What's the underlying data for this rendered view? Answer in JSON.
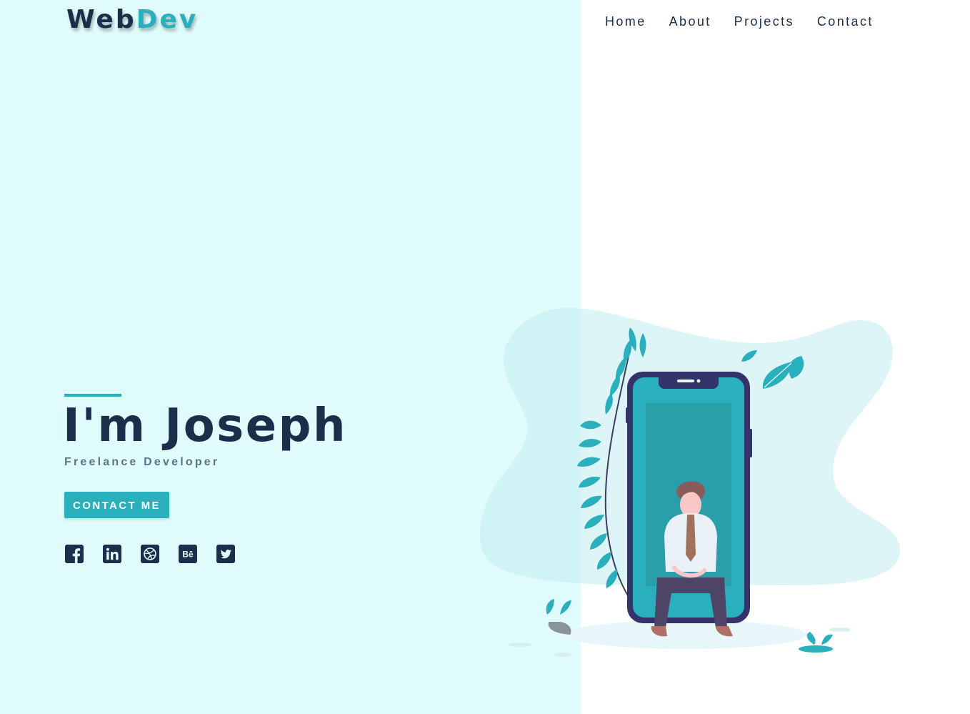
{
  "header": {
    "logo_part_a": "Web",
    "logo_part_b": "Dev",
    "nav": [
      {
        "label": "Home"
      },
      {
        "label": "About"
      },
      {
        "label": "Projects"
      },
      {
        "label": "Contact"
      }
    ]
  },
  "hero": {
    "title": "I'm Joseph",
    "subtitle": "Freelance Developer",
    "cta_label": "CONTACT ME",
    "social_icons": [
      "facebook-icon",
      "linkedin-icon",
      "dribbble-icon",
      "behance-icon",
      "twitter-icon"
    ],
    "behance_glyph": "Bē"
  },
  "colors": {
    "accent": "#2ab0bd",
    "navy": "#1c2e4a",
    "left_panel_bg": "#e0fbfc",
    "subtitle": "#5a7488"
  },
  "illustration": {
    "icon": "person-sitting-in-phone-illustration"
  }
}
